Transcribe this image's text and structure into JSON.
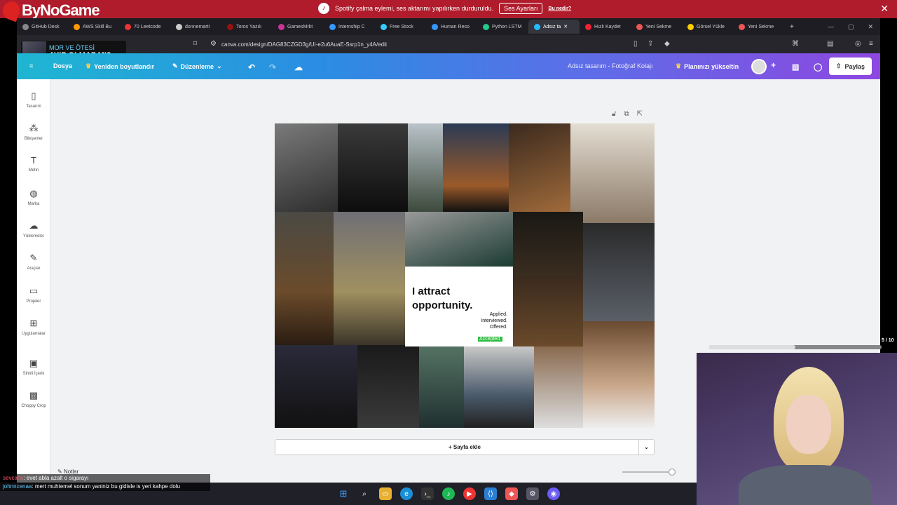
{
  "overlay": {
    "logo": "ByNoGame",
    "spotify_msg": "Spotify çalma eylemi, ses aktarımı yapılırken durduruldu.",
    "spotify_btn": "Ses Ayarları",
    "spotify_link": "Bu nedir?",
    "close": "✕"
  },
  "tabs": [
    {
      "label": "GitHub Desk",
      "color": "#999"
    },
    {
      "label": "AWS Skill Bu",
      "color": "#f90"
    },
    {
      "label": "70 Leetcode",
      "color": "#e33"
    },
    {
      "label": "donnemarti",
      "color": "#ccc"
    },
    {
      "label": "Toros Yazılı",
      "color": "#911"
    },
    {
      "label": "GamesMrkt",
      "color": "#c39"
    },
    {
      "label": "Internship C",
      "color": "#39f"
    },
    {
      "label": "Free Stock",
      "color": "#3cf"
    },
    {
      "label": "Human Reso",
      "color": "#39f"
    },
    {
      "label": "Python LSTM",
      "color": "#2c8"
    },
    {
      "label": "Adsız ta",
      "color": "#2bf",
      "active": true
    },
    {
      "label": "Hızlı Kaydet",
      "color": "#e23"
    },
    {
      "label": "Yeni Sekme",
      "color": "#e55"
    },
    {
      "label": "Görsel Yükle",
      "color": "#fc0"
    },
    {
      "label": "Yeni Sekme",
      "color": "#e55"
    }
  ],
  "address": {
    "url": "canva.com/design/DAG83CZGD3g/UI-e2u6AuaE-Ssrp1n_y4A/edit"
  },
  "stream": {
    "sub": "MOR VE ÖTESİ",
    "title": "AYIP OLMAZ MI?"
  },
  "header": {
    "menu_file": "Dosya",
    "resize": "Yeniden boyutlandır",
    "edit": "Düzenleme",
    "doc_title": "Adsız tasarım - Fotoğraf Kolajı",
    "upgrade": "Planınızı yükseltin",
    "share": "Paylaş"
  },
  "sidebar": [
    {
      "label": "Tasarım",
      "icon": "▯"
    },
    {
      "label": "Bileşenler",
      "icon": "⁂"
    },
    {
      "label": "Metin",
      "icon": "T"
    },
    {
      "label": "Marka",
      "icon": "◍"
    },
    {
      "label": "Yüklemeler",
      "icon": "☁"
    },
    {
      "label": "Araçlar",
      "icon": "✎"
    },
    {
      "label": "Projeler",
      "icon": "▭"
    },
    {
      "label": "Uygulamalar",
      "icon": "⊞"
    },
    {
      "label": "Sihirli İçerik",
      "icon": "▣"
    },
    {
      "label": "Choppy Crop",
      "icon": "▩"
    }
  ],
  "collage": {
    "quote": "I attract opportunity.",
    "quote_sub": "Applied. Interviewed. Offered.",
    "accepted": "Accepted."
  },
  "workspace": {
    "add_page": "+ Sayfa ekle",
    "notes": "Notlar"
  },
  "chat": [
    {
      "user": "sevcanx",
      "msg": ": evet abla azalt o sigarayı"
    },
    {
      "user": "johnncenaa",
      "msg": ": mert muhtemel sonum yaniniz bu gidisle is yeri kahpe dolu"
    }
  ],
  "cam": {
    "counter": "5 / 10"
  }
}
